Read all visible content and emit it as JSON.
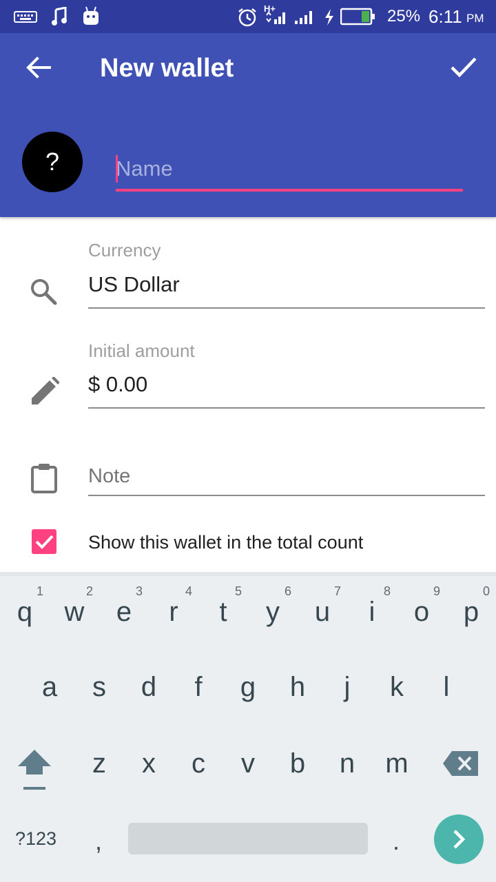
{
  "status_bar": {
    "battery_percent": "25%",
    "time": "6:11",
    "ampm": "PM",
    "network": "H+"
  },
  "app_bar": {
    "title": "New wallet",
    "name_placeholder": "Name",
    "avatar_symbol": "?"
  },
  "form": {
    "currency_label": "Currency",
    "currency_value": "US Dollar",
    "amount_label": "Initial amount",
    "amount_value": "$ 0.00",
    "note_placeholder": "Note",
    "show_total_label": "Show this wallet in the total count",
    "show_total_checked": true
  },
  "keyboard": {
    "row1": [
      "q",
      "w",
      "e",
      "r",
      "t",
      "y",
      "u",
      "i",
      "o",
      "p"
    ],
    "row1_numbers": [
      "1",
      "2",
      "3",
      "4",
      "5",
      "6",
      "7",
      "8",
      "9",
      "0"
    ],
    "row2": [
      "a",
      "s",
      "d",
      "f",
      "g",
      "h",
      "j",
      "k",
      "l"
    ],
    "row3": [
      "z",
      "x",
      "c",
      "v",
      "b",
      "n",
      "m"
    ],
    "symbols_label": "?123",
    "comma": ",",
    "period": "."
  },
  "colors": {
    "primary": "#3f51b5",
    "primary_dark": "#2f3c9e",
    "accent": "#ff4081",
    "keyboard_action": "#4db6ac"
  }
}
